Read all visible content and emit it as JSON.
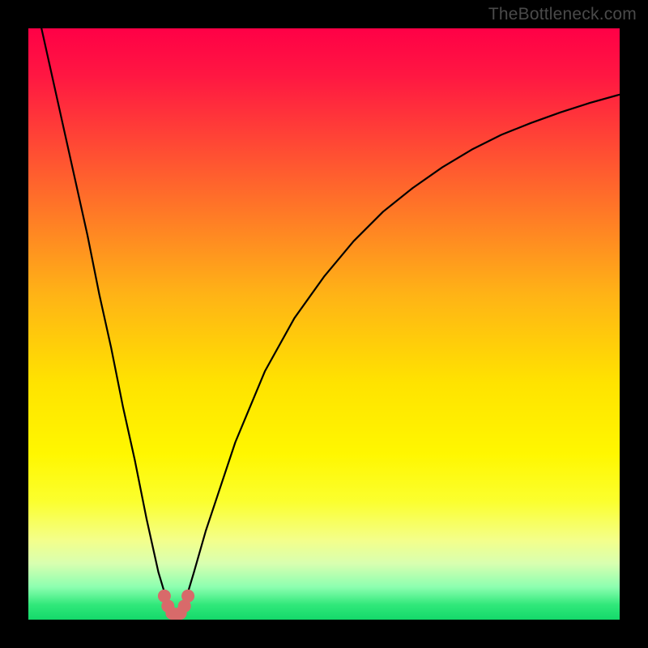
{
  "watermark": "TheBottleneck.com",
  "chart_data": {
    "type": "line",
    "title": "",
    "xlabel": "",
    "ylabel": "",
    "xlim": [
      0,
      100
    ],
    "ylim": [
      0,
      100
    ],
    "x_optimum": 25,
    "curve": {
      "x": [
        0,
        2,
        4,
        6,
        8,
        10,
        12,
        14,
        16,
        18,
        20,
        22,
        23.5,
        24.5,
        25,
        25.5,
        26.5,
        28,
        30,
        32,
        35,
        40,
        45,
        50,
        55,
        60,
        65,
        70,
        75,
        80,
        85,
        90,
        95,
        100
      ],
      "y": [
        110,
        101,
        92,
        83,
        74,
        65,
        55,
        46,
        36,
        27,
        17,
        8,
        3,
        1,
        0.5,
        1,
        3,
        8,
        15,
        21,
        30,
        42,
        51,
        58,
        64,
        69,
        73,
        76.5,
        79.5,
        82,
        84,
        85.8,
        87.4,
        88.8
      ]
    },
    "bottom_markers": {
      "x": [
        23.0,
        23.6,
        24.3,
        25.0,
        25.7,
        26.4,
        27.0
      ],
      "y": [
        4.0,
        2.3,
        1.1,
        0.6,
        1.1,
        2.3,
        4.0
      ]
    },
    "gradient_stops": [
      {
        "pos": 0.0,
        "color": "#ff0046"
      },
      {
        "pos": 0.08,
        "color": "#ff1742"
      },
      {
        "pos": 0.25,
        "color": "#ff5f2e"
      },
      {
        "pos": 0.45,
        "color": "#ffb316"
      },
      {
        "pos": 0.6,
        "color": "#ffe300"
      },
      {
        "pos": 0.72,
        "color": "#fff700"
      },
      {
        "pos": 0.8,
        "color": "#fbff2e"
      },
      {
        "pos": 0.865,
        "color": "#f4ff8a"
      },
      {
        "pos": 0.905,
        "color": "#d8ffb0"
      },
      {
        "pos": 0.945,
        "color": "#8cffb0"
      },
      {
        "pos": 0.975,
        "color": "#30e87a"
      },
      {
        "pos": 1.0,
        "color": "#14d96a"
      }
    ],
    "marker_color": "#d86a6a",
    "curve_color": "#000000"
  }
}
